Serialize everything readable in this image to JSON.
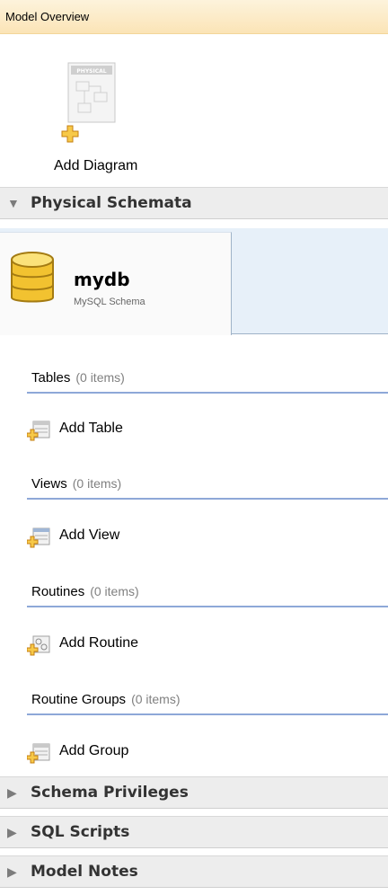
{
  "header": {
    "title": "Model Overview"
  },
  "diagram": {
    "add_label": "Add Diagram",
    "doc_tag": "PHYSICAL"
  },
  "sections": {
    "physical_schemata": "Physical Schemata",
    "schema_privileges": "Schema Privileges",
    "sql_scripts": "SQL Scripts",
    "model_notes": "Model Notes"
  },
  "arrows": {
    "expanded": "▼",
    "collapsed": "▶"
  },
  "schema": {
    "name": "mydb",
    "type": "MySQL Schema"
  },
  "groups": [
    {
      "title": "Tables",
      "count": "(0 items)",
      "add_label": "Add Table"
    },
    {
      "title": "Views",
      "count": "(0 items)",
      "add_label": "Add View"
    },
    {
      "title": "Routines",
      "count": "(0 items)",
      "add_label": "Add Routine"
    },
    {
      "title": "Routine Groups",
      "count": "(0 items)",
      "add_label": "Add Group"
    }
  ],
  "colors": {
    "header_bg": "#fbe4b6",
    "section_bg": "#ededed",
    "divider": "#8ea8d8",
    "db_icon": "#f2c230",
    "plus_icon": "#e8a419"
  }
}
